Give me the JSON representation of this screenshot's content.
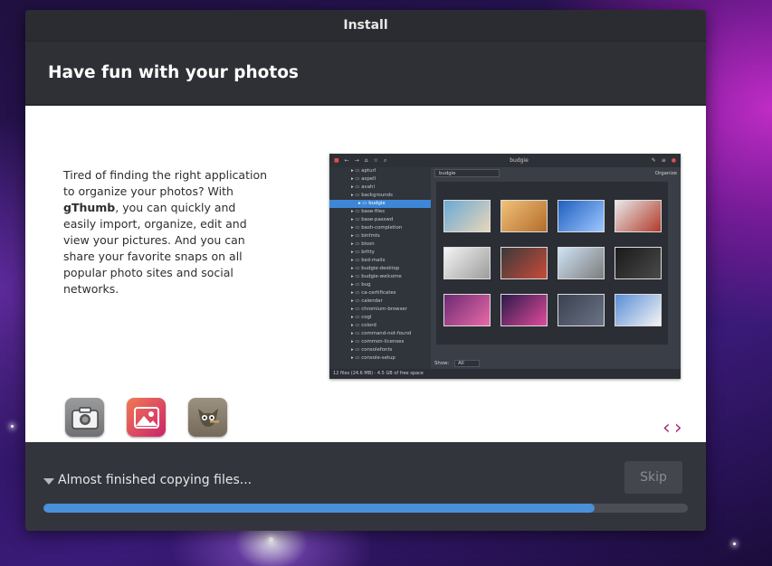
{
  "window": {
    "title": "Install"
  },
  "header": {
    "title": "Have fun with your photos"
  },
  "slide": {
    "text_before": "Tired of finding the right application to organize your photos? With ",
    "app_name": "gThumb",
    "text_after": ", you can quickly and easily import, organize, edit and view your pictures. And you can share your favorite snaps on all popular photo sites and social networks.",
    "screenshot": {
      "window_title": "budgie",
      "location": "budgie",
      "organize_label": "Organize",
      "show_label": "Show:",
      "show_value": "All",
      "status": "12 files (24.6 MB) · 4.5 GB of free space",
      "tree": [
        "apturl",
        "aspell",
        "avahi",
        "backgrounds",
        "budgie",
        "base-files",
        "base-passwd",
        "bash-completion",
        "binfmts",
        "bison",
        "brltty",
        "bsd-mailx",
        "budgie-desktop",
        "budgie-welcome",
        "bug",
        "ca-certificates",
        "calendar",
        "chromium-browser",
        "cogl",
        "colord",
        "command-not-found",
        "common-licenses",
        "consolefonts",
        "console-setup"
      ],
      "selected_index": 4,
      "thumbnails": [
        [
          "#6aa9d6",
          "#e8d6b8"
        ],
        [
          "#f0c27a",
          "#b46c2a"
        ],
        [
          "#1f5fbf",
          "#9fc7ff"
        ],
        [
          "#e9e9e9",
          "#b13a2a"
        ],
        [
          "#f4f4f4",
          "#9c9c9c"
        ],
        [
          "#3a3a3a",
          "#c94a3a"
        ],
        [
          "#cfe3f5",
          "#7c7c7c"
        ],
        [
          "#1a1a1a",
          "#4a4a4a"
        ],
        [
          "#6d2a73",
          "#e86aa8"
        ],
        [
          "#2a1a4a",
          "#e04a9a"
        ],
        [
          "#3a4150",
          "#6a7385"
        ],
        [
          "#5a8ed6",
          "#f4f4f4"
        ]
      ]
    },
    "icons": [
      {
        "name": "camera-icon",
        "bg": "#7b7d7f"
      },
      {
        "name": "photos-icon",
        "bg": "#d33a5c"
      },
      {
        "name": "gimp-icon",
        "bg": "#8a8070"
      }
    ],
    "nav": {
      "prev": "‹",
      "next": "›"
    }
  },
  "footer": {
    "status": "Almost finished copying files...",
    "skip_label": "Skip",
    "progress": 0.855
  }
}
